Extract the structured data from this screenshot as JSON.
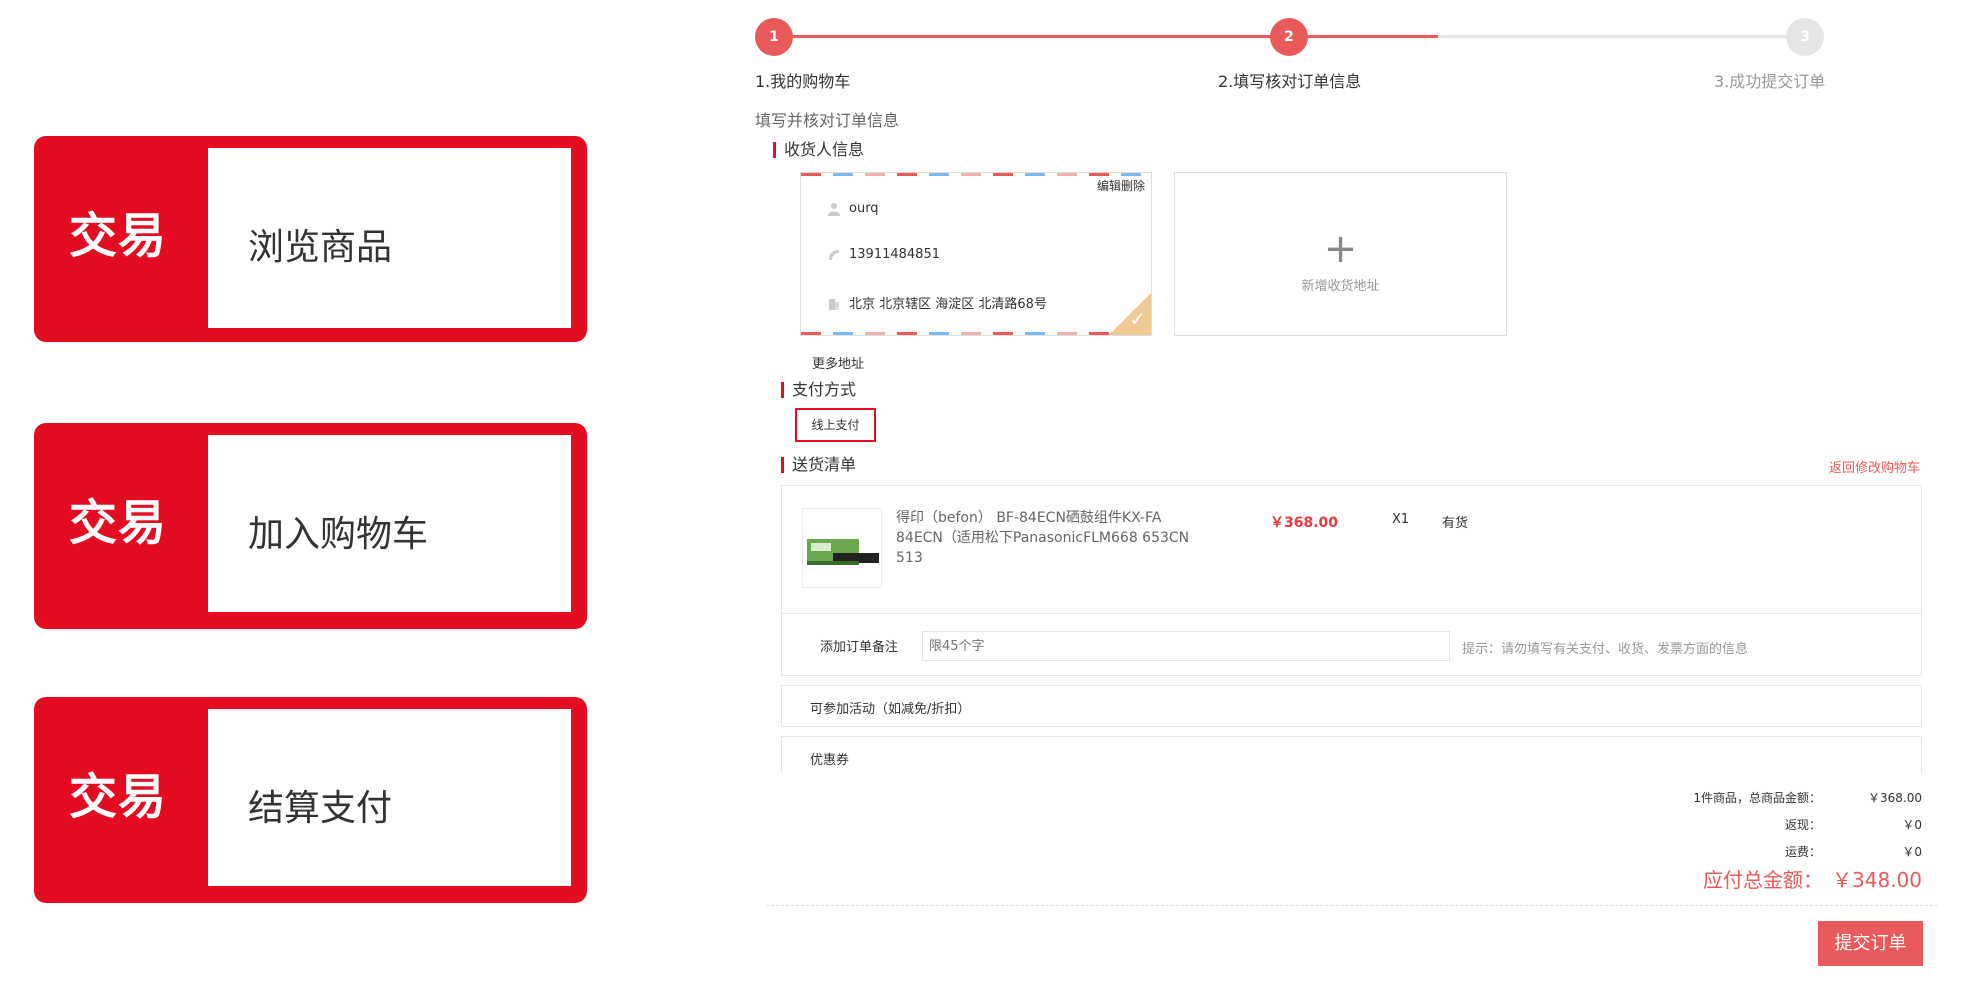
{
  "left_cards": [
    {
      "tag": "交易",
      "label": "浏览商品"
    },
    {
      "tag": "交易",
      "label": "加入购物车"
    },
    {
      "tag": "交易",
      "label": "结算支付"
    }
  ],
  "progress": {
    "steps": [
      {
        "number": "1",
        "label": "1.我的购物车"
      },
      {
        "number": "2",
        "label": "2.填写核对订单信息"
      },
      {
        "number": "3",
        "label": "3.成功提交订单"
      }
    ],
    "fraction_complete": 0.64
  },
  "page_subtitle": "填写并核对订单信息",
  "receiver": {
    "section_title": "收货人信息",
    "edit_label": "编辑",
    "delete_label": "删除",
    "name": "ourq",
    "phone": "13911484851",
    "address": "北京  北京辖区  海淀区  北清路68号",
    "add_label": "新增收货地址",
    "more_label": "更多地址"
  },
  "payment": {
    "section_title": "支付方式",
    "option_label": "线上支付"
  },
  "delivery": {
    "section_title": "送货清单",
    "back_link": "返回修改购物车",
    "item": {
      "name_line1": "得印（befon） BF-84ECN硒鼓组件KX-FA",
      "name_line2": "84ECN（适用松下PanasonicFLM668 653CN 513",
      "price": "￥368.00",
      "qty": "X1",
      "stock": "有货"
    },
    "remark_label": "添加订单备注",
    "remark_placeholder": "限45个字",
    "remark_tip": "提示：请勿填写有关支付、收货、发票方面的信息"
  },
  "activities_label": "可参加活动（如减免/折扣）",
  "coupon_label": "优惠券",
  "summary": {
    "items_label": "1件商品，总商品金额：",
    "items_value": "￥368.00",
    "cashback_label": "返现：",
    "cashback_value": "￥0",
    "shipping_label": "运费：",
    "shipping_value": "￥0",
    "total_label": "应付总金额：",
    "total_value": "￥348.00"
  },
  "submit_label": "提交订单",
  "colors": {
    "brand_red": "#e30c20",
    "accent_red": "#e95a5a",
    "inactive_gray": "#e5e5e5"
  }
}
